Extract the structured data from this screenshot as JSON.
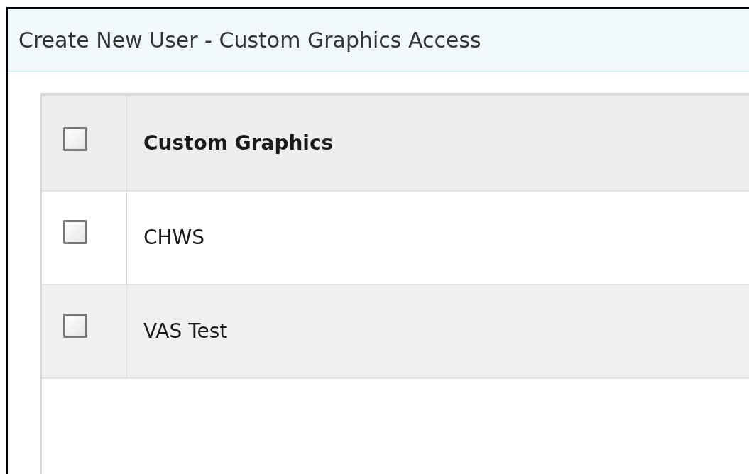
{
  "panel": {
    "title": "Create New User - Custom Graphics Access"
  },
  "table": {
    "header": {
      "label": "Custom Graphics",
      "checked": false
    },
    "rows": [
      {
        "label": "CHWS",
        "checked": false
      },
      {
        "label": "VAS Test",
        "checked": false
      }
    ]
  }
}
